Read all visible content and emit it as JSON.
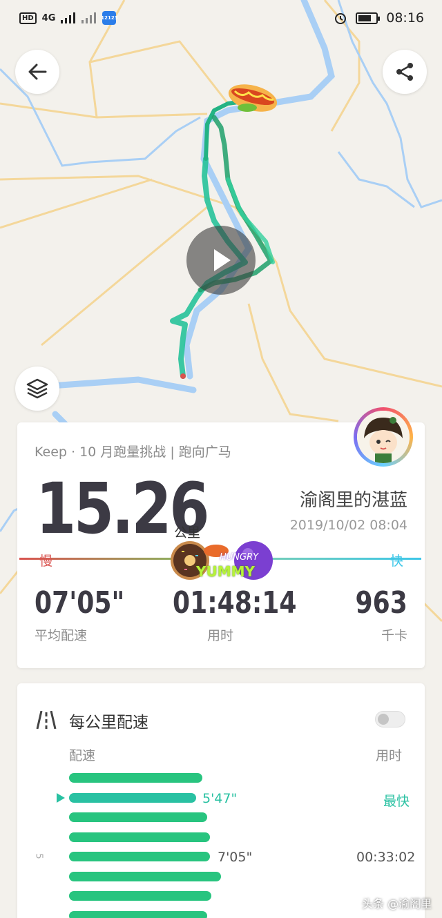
{
  "status_bar": {
    "network_labels": [
      "HD",
      "4G"
    ],
    "app_badge": "12123",
    "time": "08:16"
  },
  "map": {
    "buttons": {
      "back": "back-arrow-icon",
      "share": "share-icon",
      "layers": "layers-icon",
      "play": "play-icon"
    }
  },
  "summary": {
    "activity_title": "Keep · 10 月跑量挑战 | 跑向广马",
    "distance": "15.26",
    "distance_unit": "公里",
    "username": "渝阁里的湛蓝",
    "datetime": "2019/10/02 08:04",
    "slow_label": "慢",
    "fast_label": "快",
    "stats": [
      {
        "value": "07'05\"",
        "label": "平均配速"
      },
      {
        "value": "01:48:14",
        "label": "用时"
      },
      {
        "value": "963",
        "label": "千卡"
      }
    ],
    "sticker_text": [
      "HUNGRY",
      "YUMMY"
    ]
  },
  "splits": {
    "title": "每公里配速",
    "col_pace": "配速",
    "col_time": "用时",
    "fastest_label": "最快",
    "fastest_value": "5'47\"",
    "avg_value": "7'05\"",
    "km_marker": "5",
    "split_time": "00:33:02",
    "bar_fractions": [
      0.87,
      0.83,
      0.9,
      0.92,
      0.92,
      0.99,
      0.93,
      0.9
    ]
  },
  "watermark": "头条 @渝阁里",
  "colors": {
    "route": "#2ecc8f",
    "river": "#a9cff5",
    "road": "#f4d79a",
    "slow": "#d9534f",
    "fast": "#3cc6e8",
    "bar": "#28c47f"
  }
}
